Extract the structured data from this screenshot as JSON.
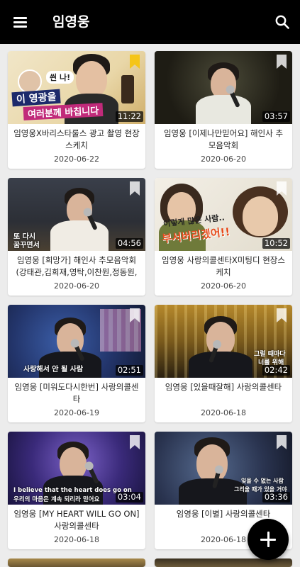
{
  "appbar": {
    "title": "임영웅"
  },
  "videos": [
    {
      "title": "임영웅X바리스타룰스 광고 촬영 현장스케치",
      "date": "2020-06-22",
      "duration": "11:22",
      "bookmarked": true,
      "caption_a": "이 영광을",
      "caption_b": "여러분께 바칩니다",
      "caption_c": "씐 나!"
    },
    {
      "title": "임영웅 [이제나만믿어요] 해인사 추모음악회",
      "date": "2020-06-20",
      "duration": "03:57",
      "bookmarked": false
    },
    {
      "title": "임영웅  [희망가] 해인사 추모음악회(강태관,김희재,영탁,이찬원,정동원,장민호)",
      "date": "2020-06-20",
      "duration": "04:56",
      "bookmarked": false,
      "caption_a": "또 다시",
      "caption_b": "꿈꾸면서"
    },
    {
      "title": "임영웅 사랑의콜센타X미팅디 현장스케치",
      "date": "2020-06-20",
      "duration": "10:52",
      "bookmarked": false,
      "caption_a": "이렇게 많은 사람..",
      "caption_b": "부서버리겠어!!"
    },
    {
      "title": "임영웅 [미워도다시한번] 사랑의콜센타",
      "date": "2020-06-19",
      "duration": "02:51",
      "bookmarked": false,
      "caption_a": "사랑해서 안 될 사람"
    },
    {
      "title": "임영웅 [있을때잘해] 사랑의콜센타",
      "date": "2020-06-18",
      "duration": "02:42",
      "bookmarked": false,
      "caption_a": "그럴 때마다",
      "caption_b": "너를 위해"
    },
    {
      "title": "임영웅 [MY HEART WILL GO ON] 사랑의콜센타",
      "date": "2020-06-18",
      "duration": "03:04",
      "bookmarked": false,
      "caption_a": "I believe that the heart does go on",
      "caption_b": "우리의 마음은 계속 되리라 믿어요"
    },
    {
      "title": "임영웅 [이별] 사랑의콜센타",
      "date": "2020-06-18",
      "duration": "03:36",
      "bookmarked": false,
      "caption_a": "잊을 수 없는 사람",
      "caption_b": "그리울 때가 있을 거야"
    }
  ],
  "colors": {
    "appbar": "#000000",
    "background": "#ececec",
    "bookmark_active": "#f5c518",
    "bookmark_idle": "#ffffff"
  }
}
